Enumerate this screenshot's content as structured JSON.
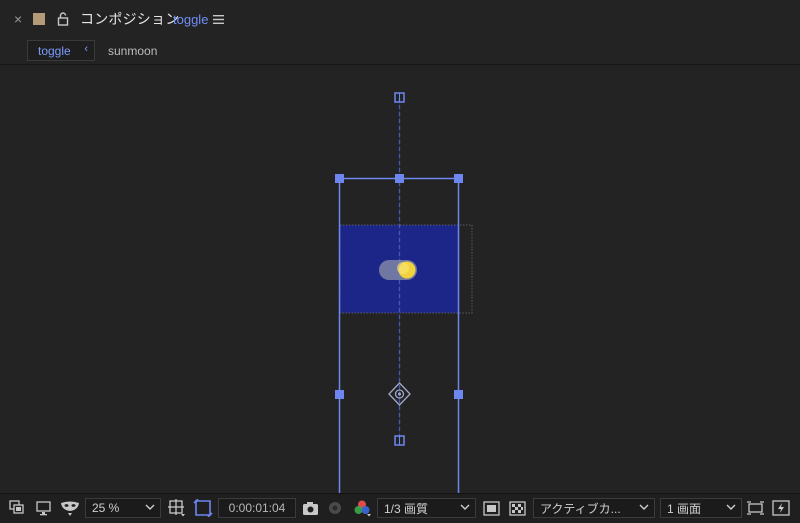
{
  "header": {
    "close_glyph": "×",
    "label_color": "#b59a7a",
    "title_prefix": "コンポジション",
    "composition_name": "toggle",
    "menu_icon": "hamburger-icon",
    "lock_icon": "unlock-icon"
  },
  "tabs": {
    "items": [
      {
        "label": "toggle",
        "active": true
      },
      {
        "label": "sunmoon",
        "active": false
      }
    ],
    "chevron": "‹"
  },
  "viewer": {
    "background": "#232323",
    "layer_color": "#1c2588",
    "handle_color": "#6e87f0",
    "toggle_knob_color": "#f2d23a"
  },
  "footer": {
    "zoom": "25 %",
    "timecode": "0:00:01:04",
    "resolution": "1/3 画質",
    "camera": "アクティブカ...",
    "views": "1 画面",
    "accent": "#6e87f0"
  }
}
